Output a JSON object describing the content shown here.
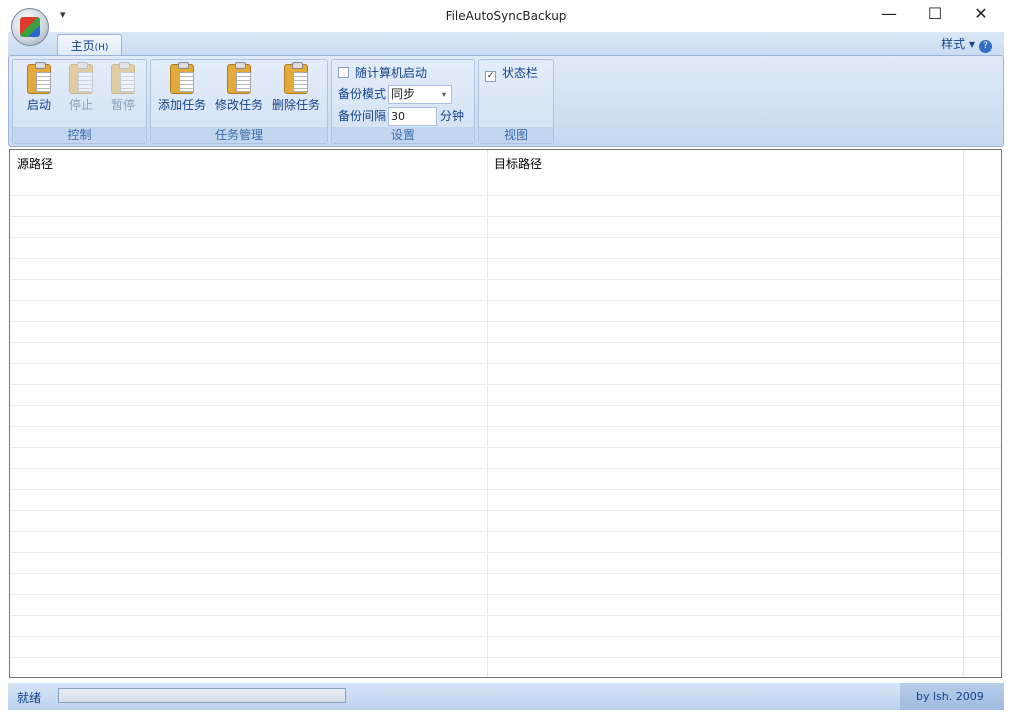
{
  "window": {
    "title": "FileAutoSyncBackup",
    "qat": "▾",
    "minimize": "—",
    "maximize": "☐",
    "close": "✕"
  },
  "ribbon": {
    "tab": "主页",
    "tab_key": "(H)",
    "style_menu": "样式 ▾",
    "help": "?",
    "control": {
      "label": "控制",
      "start": "启动",
      "stop": "停止",
      "pause": "暂停"
    },
    "tasks": {
      "label": "任务管理",
      "add": "添加任务",
      "edit": "修改任务",
      "delete": "删除任务"
    },
    "settings": {
      "label": "设置",
      "autostart": "随计算机启动",
      "mode_label": "备份模式",
      "mode_value": "同步",
      "interval_label": "备份间隔",
      "interval_value": "30",
      "interval_unit": "分钟"
    },
    "view": {
      "label": "视图",
      "statusbar": "状态栏",
      "check": "✓"
    }
  },
  "table": {
    "columns": [
      "源路径",
      "目标路径"
    ],
    "rows": []
  },
  "status": {
    "text": "就绪",
    "credit": "by lsh. 2009",
    "progress": 0
  }
}
